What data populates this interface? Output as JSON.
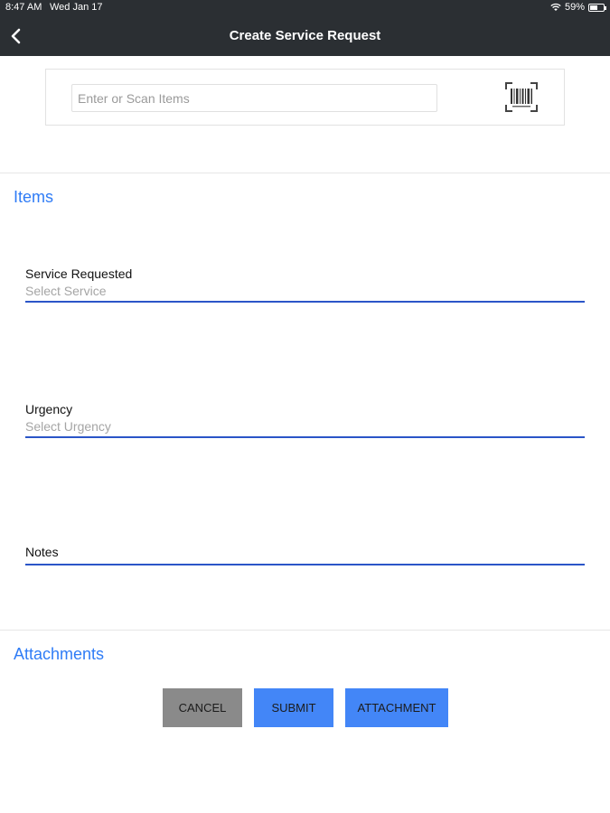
{
  "status_bar": {
    "time": "8:47 AM",
    "date": "Wed Jan 17",
    "battery_percent": "59%",
    "battery_level": 0.59
  },
  "nav": {
    "title": "Create Service Request",
    "back_icon": "chevron-left-icon"
  },
  "scan": {
    "placeholder": "Enter or Scan Items",
    "barcode_icon": "barcode-scan-icon"
  },
  "items_section": {
    "title": "Items"
  },
  "form": {
    "service": {
      "label": "Service Requested",
      "placeholder": "Select Service"
    },
    "urgency": {
      "label": "Urgency",
      "placeholder": "Select Urgency"
    },
    "notes": {
      "label": "Notes"
    }
  },
  "attachments_section": {
    "title": "Attachments"
  },
  "buttons": {
    "cancel": "CANCEL",
    "submit": "SUBMIT",
    "attachment": "ATTACHMENT"
  },
  "colors": {
    "nav_background": "#2b2f33",
    "accent": "#2f7cf6",
    "primary_button": "#4386f7",
    "cancel_button": "#8a8a8a",
    "field_underline": "#2b55c8"
  }
}
